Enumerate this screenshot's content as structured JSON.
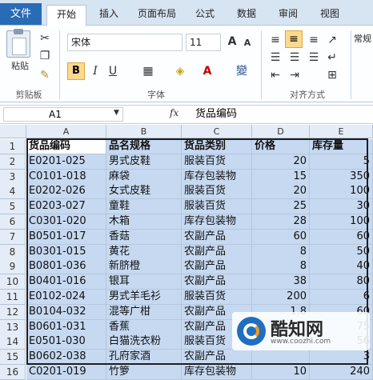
{
  "tabs": {
    "file": "文件",
    "home": "开始",
    "insert": "插入",
    "layout": "页面布局",
    "formulas": "公式",
    "data": "数据",
    "review": "审阅",
    "view": "视图"
  },
  "clipboard": {
    "paste": "粘贴",
    "group": "剪贴板"
  },
  "font": {
    "name": "宋体",
    "size": "11",
    "bold": "B",
    "italic": "I",
    "underline": "U",
    "grow": "A",
    "shrink": "A",
    "group": "字体",
    "wen": "變"
  },
  "align": {
    "group": "对齐方式"
  },
  "number": {
    "fmt": "常规"
  },
  "formula_bar": {
    "name_box": "A1",
    "fx": "fx",
    "content": "货品编码"
  },
  "columns": [
    "A",
    "B",
    "C",
    "D",
    "E"
  ],
  "rows": [
    [
      "货品编码",
      "品名规格",
      "货品类别",
      "价格",
      "库存量"
    ],
    [
      "E0201-025",
      "男式皮鞋",
      "服装百货",
      "20",
      "5"
    ],
    [
      "C0101-018",
      "麻袋",
      "库存包装物",
      "15",
      "350"
    ],
    [
      "E0202-026",
      "女式皮鞋",
      "服装百货",
      "20",
      "100"
    ],
    [
      "E0203-027",
      "童鞋",
      "服装百货",
      "25",
      "30"
    ],
    [
      "C0301-020",
      "木箱",
      "库存包装物",
      "28",
      "100"
    ],
    [
      "B0501-017",
      "香菇",
      "农副产品",
      "60",
      "60"
    ],
    [
      "B0301-015",
      "黄花",
      "农副产品",
      "8",
      "50"
    ],
    [
      "B0801-036",
      "新脐橙",
      "农副产品",
      "8",
      "40"
    ],
    [
      "B0401-016",
      "银耳",
      "农副产品",
      "38",
      "80"
    ],
    [
      "E0102-024",
      "男式羊毛衫",
      "服装百货",
      "200",
      "6"
    ],
    [
      "B0104-032",
      "混等广柑",
      "农副产品",
      "1.8",
      "60"
    ],
    [
      "B0601-031",
      "香蕉",
      "农副产品",
      "",
      "75"
    ],
    [
      "E0501-030",
      "白猫洗衣粉",
      "服装百货",
      "",
      "56"
    ],
    [
      "B0602-038",
      "孔府家酒",
      "农副产品",
      "",
      "3"
    ],
    [
      "C0201-019",
      "竹箩",
      "库存包装物",
      "10",
      "240"
    ]
  ],
  "watermark": {
    "brand": "酷知网",
    "url": "www.coozhi.com"
  }
}
